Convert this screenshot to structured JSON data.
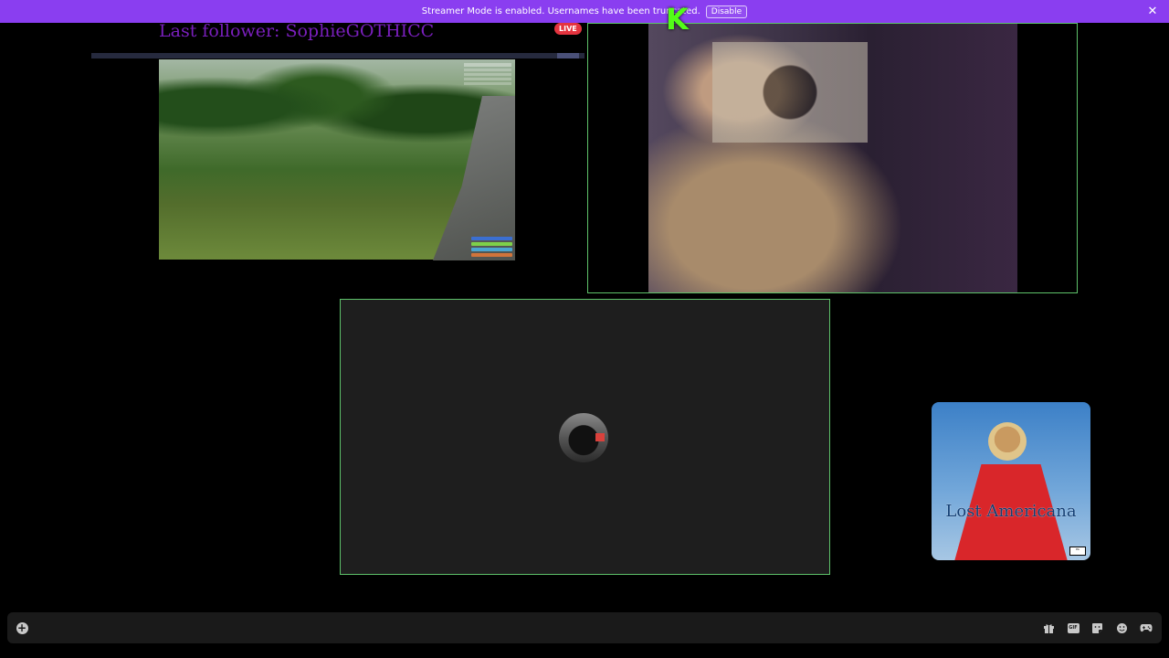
{
  "notice": {
    "message": "Streamer Mode is enabled. Usernames have been truncated.",
    "action_label": "Disable",
    "close_icon": "close-icon"
  },
  "screenshare": {
    "overlay_text": "Last follower: SophieGOTHICC",
    "live_label": "LIVE"
  },
  "colors": {
    "banner": "#8a3ef0",
    "tile_border": "#5ec26a",
    "live": "#e4343f",
    "overlay_text": "#7a1fbd",
    "kick_green": "#53fc18"
  },
  "webcam": {
    "logo_letter": "K"
  },
  "album": {
    "title": "Lost Americana"
  },
  "controls": {
    "icons": [
      "plus-circle-icon",
      "gift-icon",
      "gif-icon",
      "sticker-icon",
      "emoji-icon",
      "gamepad-icon"
    ]
  }
}
